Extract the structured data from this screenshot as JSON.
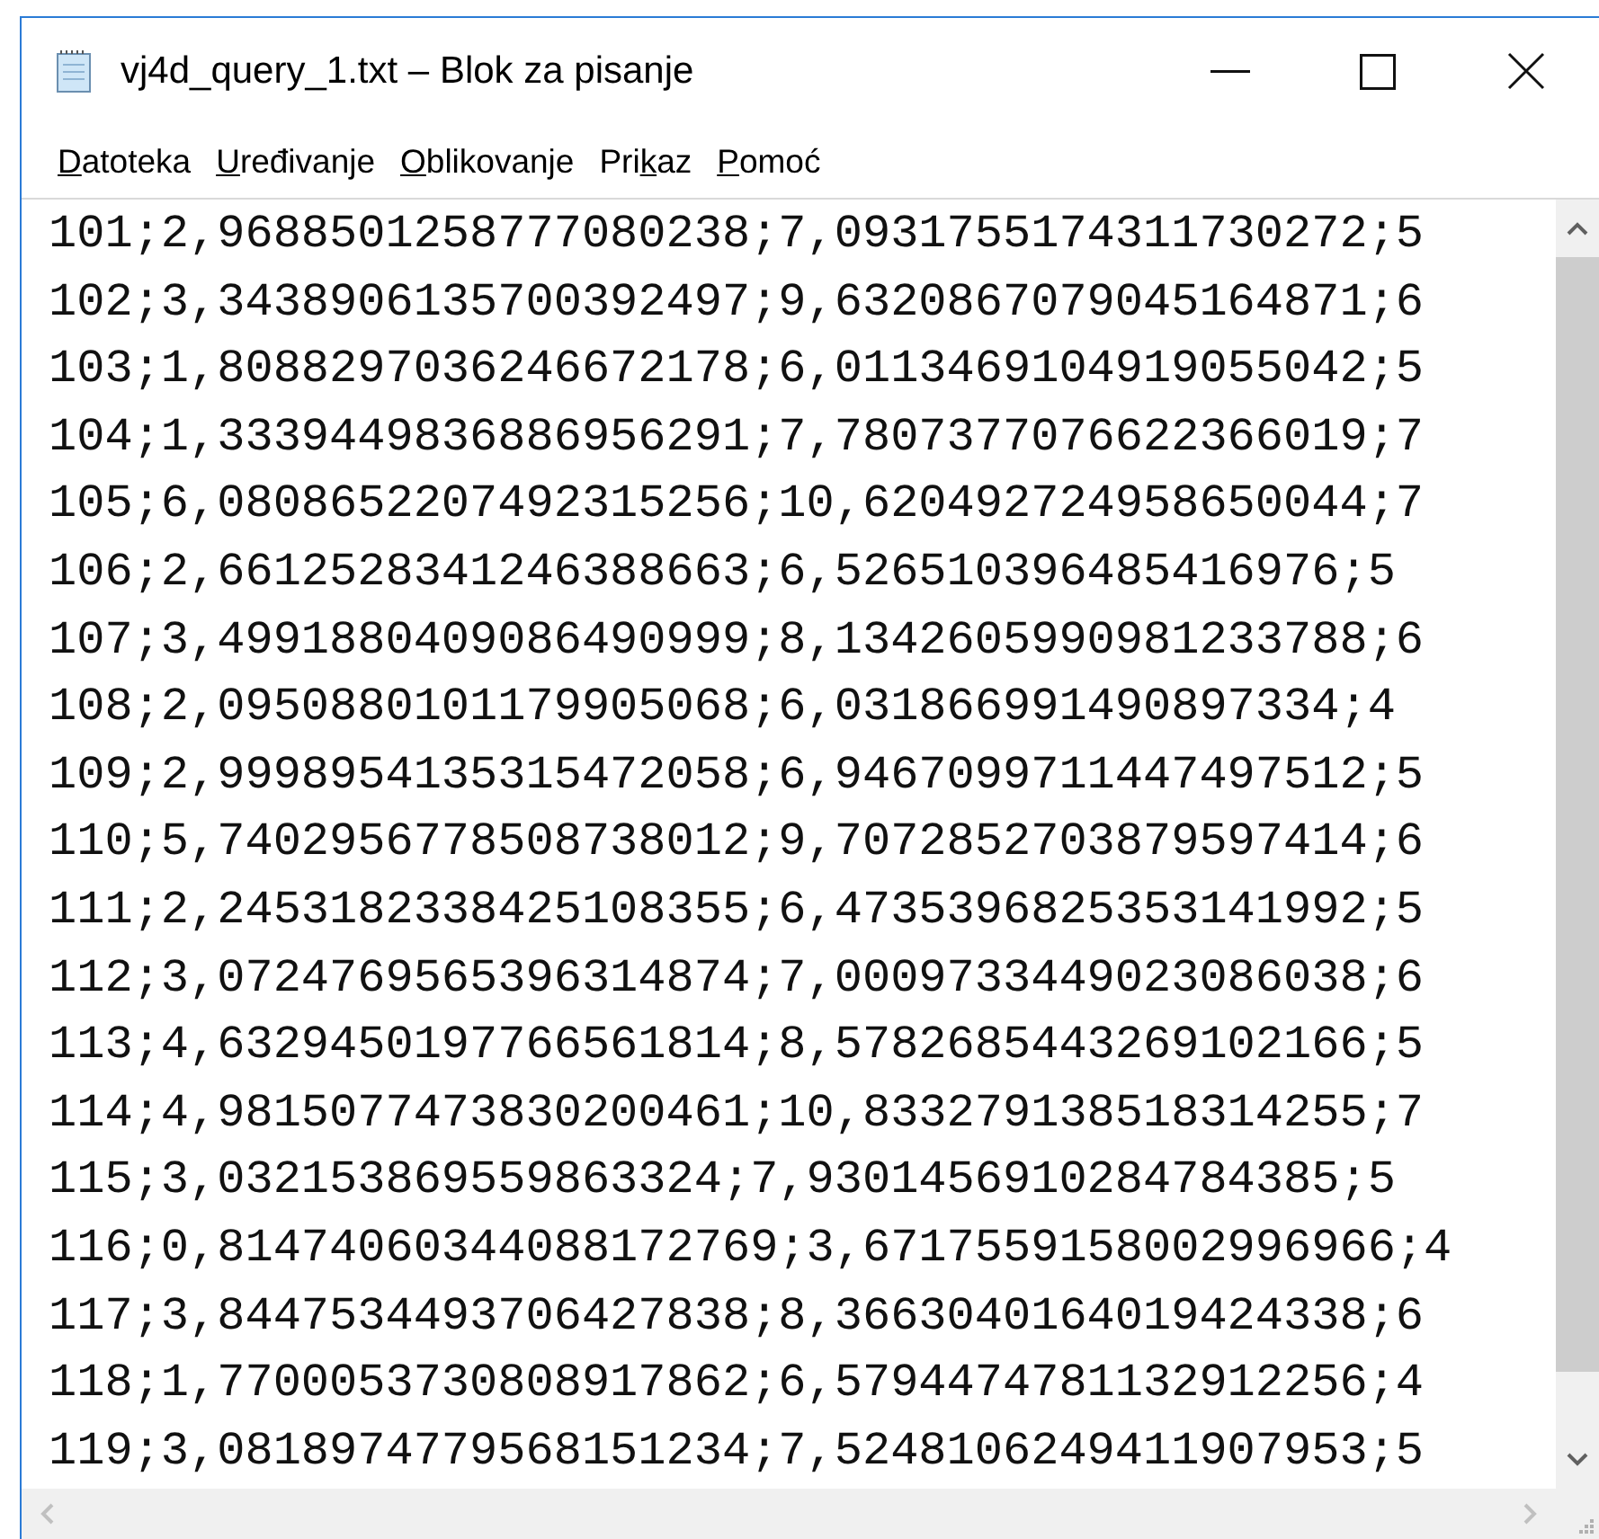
{
  "window": {
    "title": "vj4d_query_1.txt – Blok za pisanje"
  },
  "menu": [
    {
      "key": "D",
      "post": "atoteka"
    },
    {
      "key": "U",
      "post": "ređivanje"
    },
    {
      "key": "O",
      "post": "blikovanje"
    },
    {
      "pre": "Pri",
      "key": "k",
      "post": "az"
    },
    {
      "key": "P",
      "post": "omoć"
    }
  ],
  "editor": {
    "lines": [
      "101;2,9688501258777080238;7,0931755174311730272;5",
      "102;3,3438906135700392497;9,6320867079045164871;6",
      "103;1,8088297036246672178;6,0113469104919055042;5",
      "104;1,3339449836886956291;7,7807377076622366019;7",
      "105;6,0808652207492315256;10,620492724958650044;7",
      "106;2,6612528341246388663;6,526510396485416976;5",
      "107;3,4991880409086490999;8,1342605990981233788;6",
      "108;2,0950880101179905068;6,031866991490897334;4",
      "109;2,9998954135315472058;6,9467099711447497512;5",
      "110;5,7402956778508738012;9,7072852703879597414;6",
      "111;2,2453182338425108355;6,4735396825353141992;5",
      "112;3,0724769565396314874;7,0009733449023086038;6",
      "113;4,6329450197766561814;8,5782685443269102166;5",
      "114;4,9815077473830200461;10,833279138518314255;7",
      "115;3,032153869559863324;7,9301456910284784385;5",
      "116;0,81474060344088172769;3,6717559158002996966;4",
      "117;3,8447534493706427838;8,3663040164019424338;6",
      "118;1,7700053730808917862;6,5794474781132912256;4",
      "119;3,0818974779568151234;7,5248106249411907953;5"
    ]
  }
}
